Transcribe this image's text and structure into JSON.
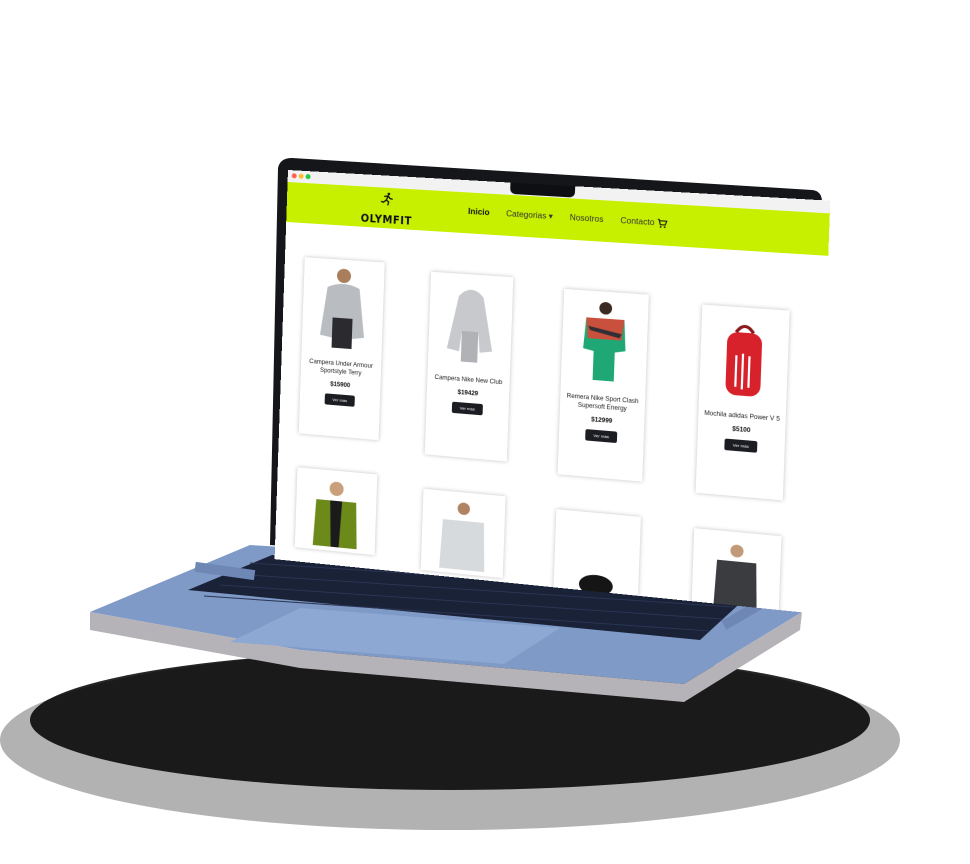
{
  "brand": {
    "name": "OLYMFIT",
    "logo_icon": "runner-icon"
  },
  "nav": {
    "items": [
      {
        "label": "Inicio"
      },
      {
        "label": "Categorias ▾"
      },
      {
        "label": "Nosotros"
      },
      {
        "label": "Contacto"
      }
    ],
    "cart_icon": "cart-icon"
  },
  "products": [
    {
      "name": "Campera Under Armour Sportstyle Terry",
      "price": "$15900",
      "button": "Ver más"
    },
    {
      "name": "Campera Nike New Club",
      "price": "$19429",
      "button": "Ver más"
    },
    {
      "name": "Remera Nike Sport Clash Supersoft Energy",
      "price": "$12999",
      "button": "Ver más"
    },
    {
      "name": "Mochila adidas Power V 5",
      "price": "$5100",
      "button": "Ver más"
    }
  ],
  "colors": {
    "header": "#c7f000",
    "button": "#1b1d22",
    "laptop_base": "#7f9ac7"
  }
}
